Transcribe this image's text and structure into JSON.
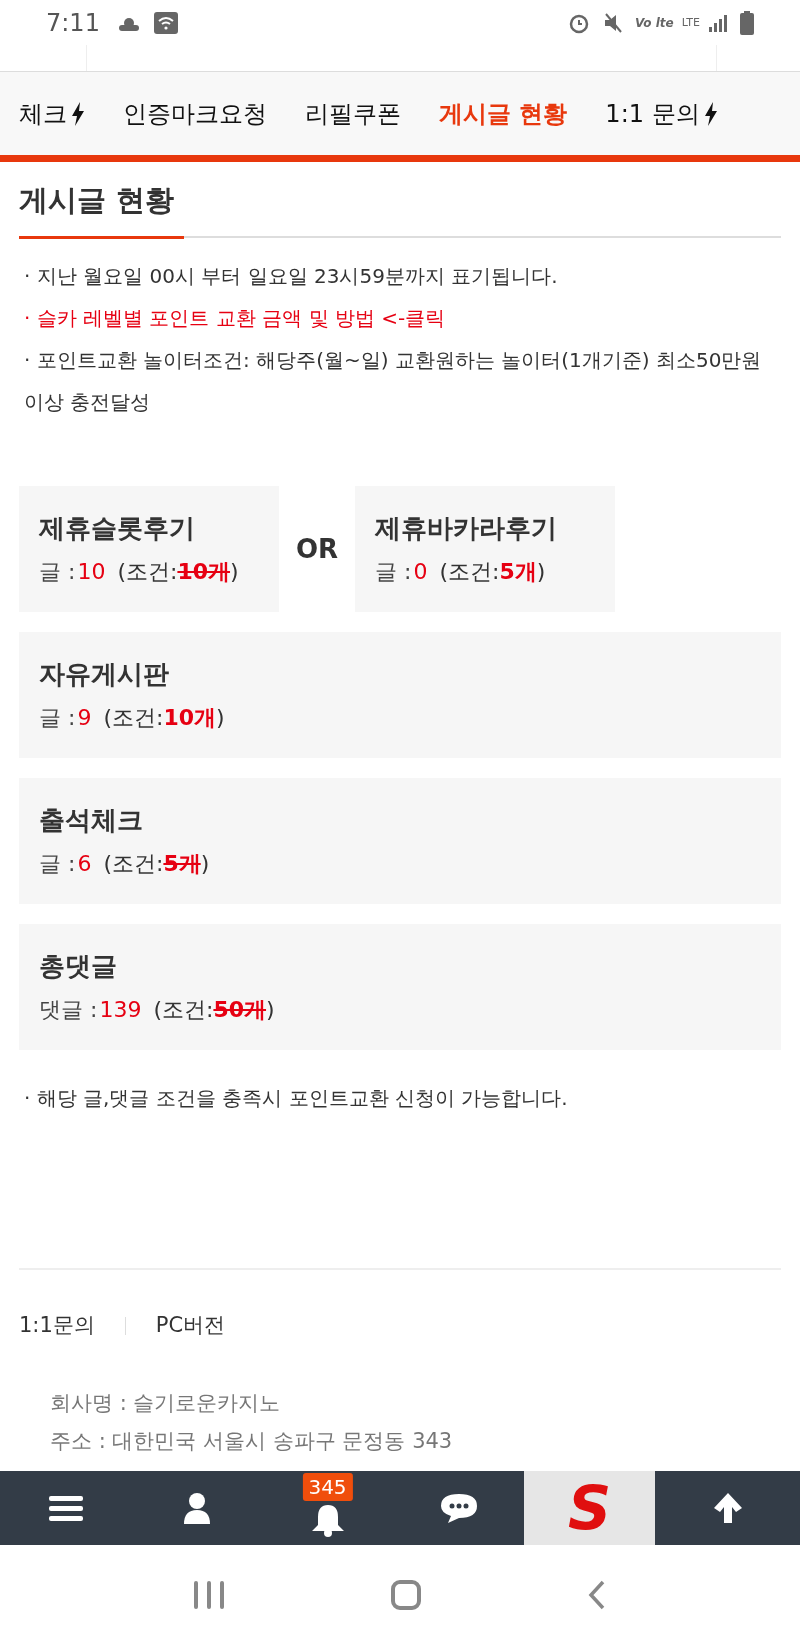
{
  "status_bar": {
    "time": "7:11",
    "volte": "Vo lte",
    "network": "LTE"
  },
  "tabs": [
    {
      "label": "체크",
      "selected": false,
      "flash": true
    },
    {
      "label": "인증마크요청",
      "selected": false,
      "flash": false
    },
    {
      "label": "리필쿠폰",
      "selected": false,
      "flash": false
    },
    {
      "label": "게시글 현황",
      "selected": true,
      "flash": false
    },
    {
      "label": "1:1 문의",
      "selected": false,
      "flash": true
    }
  ],
  "heading": "게시글 현황",
  "notes": [
    {
      "kind": "plain",
      "text": "· 지난 월요일 00시 부터 일요일 23시59분까지 표기됩니다."
    },
    {
      "kind": "link",
      "text": "· 슬카 레벨별 포인트 교환 금액 및 방법 <-클릭"
    },
    {
      "kind": "plain",
      "text": "· 포인트교환 놀이터조건: 해당주(월~일) 교환원하는 놀이터(1개기준) 최소50만원이상 충전달성"
    }
  ],
  "groups": [
    {
      "kind": "pair",
      "separator": "OR",
      "boards": [
        {
          "title": "제휴슬롯후기",
          "label": "글 :",
          "count": "10",
          "condition_label": "(조건:",
          "condition": "10개",
          "close": ")",
          "met": true
        },
        {
          "title": "제휴바카라후기",
          "label": "글 :",
          "count": "0",
          "condition_label": "(조건:",
          "condition": "5개",
          "close": ")",
          "met": false
        }
      ]
    },
    {
      "kind": "single",
      "boards": [
        {
          "title": "자유게시판",
          "label": "글 :",
          "count": "9",
          "condition_label": "(조건:",
          "condition": "10개",
          "close": ")",
          "met": false
        }
      ]
    },
    {
      "kind": "single",
      "boards": [
        {
          "title": "출석체크",
          "label": "글 :",
          "count": "6",
          "condition_label": "(조건:",
          "condition": "5개",
          "close": ")",
          "met": true
        }
      ]
    },
    {
      "kind": "single",
      "boards": [
        {
          "title": "총댓글",
          "label": "댓글 :",
          "count": "139",
          "condition_label": "(조건:",
          "condition": "50개",
          "close": ")",
          "met": true
        }
      ]
    }
  ],
  "footnote": "· 해당 글,댓글 조건을 충족시 포인트교환 신청이 가능합니다.",
  "footer": {
    "links": [
      "1:1문의",
      "PC버전"
    ],
    "company": [
      "회사명 : 슬기로운카지노",
      "주소 : 대한민국 서울시 송파구 문정동 343"
    ]
  },
  "bottom_nav": {
    "badge": "345",
    "logo": "S"
  }
}
